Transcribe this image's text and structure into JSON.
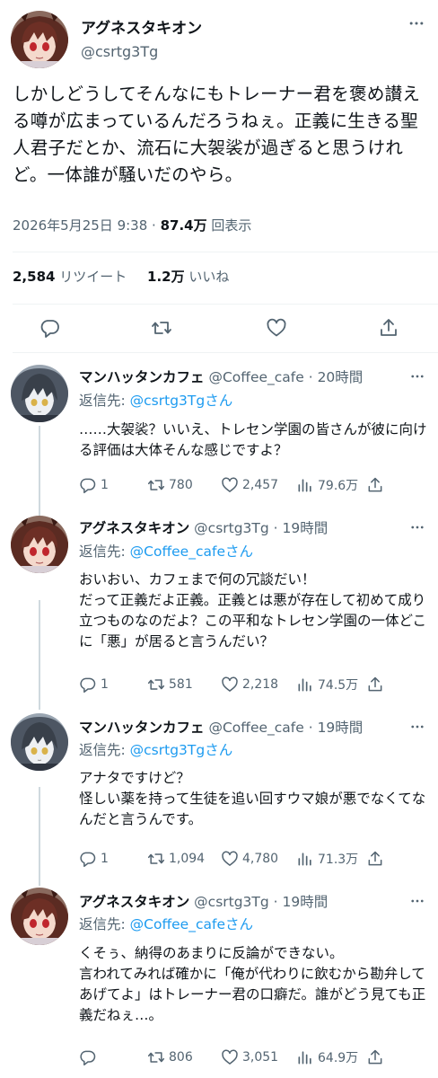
{
  "main_tweet": {
    "author_name": "アグネスタキオン",
    "author_handle": "@csrtg3Tg",
    "text": "しかしどうしてそんなにもトレーナー君を褒め讃える噂が広まっているんだろうねぇ。正義に生きる聖人君子だとか、流石に大袈裟が過ぎると思うけれど。一体誰が騒いだのやら。",
    "timestamp": "2026年5月25日 9:38",
    "separator": "·",
    "views_count": "87.4万",
    "views_label": "回表示",
    "retweets_count": "2,584",
    "retweets_label": "リツイート",
    "likes_count": "1.2万",
    "likes_label": "いいね"
  },
  "replies": [
    {
      "author_name": "マンハッタンカフェ",
      "author_handle": "@Coffee_cafe",
      "time": "· 20時間",
      "reply_prefix": "返信先: ",
      "reply_to": "@csrtg3Tgさん",
      "text": "……大袈裟？いいえ、トレセン学園の皆さんが彼に向ける評価は大体そんな感じですよ？",
      "comments": "1",
      "retweets": "780",
      "likes": "2,457",
      "views": "79.6万"
    },
    {
      "author_name": "アグネスタキオン",
      "author_handle": "@csrtg3Tg",
      "time": "· 19時間",
      "reply_prefix": "返信先: ",
      "reply_to": "@Coffee_cafeさん",
      "text": "おいおい、カフェまで何の冗談だい！\nだって正義だよ正義。正義とは悪が存在して初めて成り立つものなのだよ？この平和なトレセン学園の一体どこに「悪」が居ると言うんだい？",
      "comments": "1",
      "retweets": "581",
      "likes": "2,218",
      "views": "74.5万"
    },
    {
      "author_name": "マンハッタンカフェ",
      "author_handle": "@Coffee_cafe",
      "time": "· 19時間",
      "reply_prefix": "返信先: ",
      "reply_to": "@csrtg3Tgさん",
      "text": "アナタですけど？\n怪しい薬を持って生徒を追い回すウマ娘が悪でなくてなんだと言うんです。",
      "comments": "1",
      "retweets": "1,094",
      "likes": "4,780",
      "views": "71.3万"
    },
    {
      "author_name": "アグネスタキオン",
      "author_handle": "@csrtg3Tg",
      "time": "· 19時間",
      "reply_prefix": "返信先: ",
      "reply_to": "@Coffee_cafeさん",
      "text": "くそぅ、納得のあまりに反論ができない。\n言われてみれば確かに「俺が代わりに飲むから勘弁してあげてよ」はトレーナー君の口癖だ。誰がどう見ても正義だねぇ…。",
      "comments": "",
      "retweets": "806",
      "likes": "3,051",
      "views": "64.9万"
    }
  ],
  "icons": {
    "more": "more-dots-icon",
    "reply": "reply-icon",
    "retweet": "retweet-icon",
    "like": "heart-icon",
    "views": "views-chart-icon",
    "share": "share-icon"
  },
  "colors": {
    "text": "#0f1419",
    "secondary": "#536471",
    "link": "#1d9bf0",
    "divider": "#eff3f4"
  }
}
